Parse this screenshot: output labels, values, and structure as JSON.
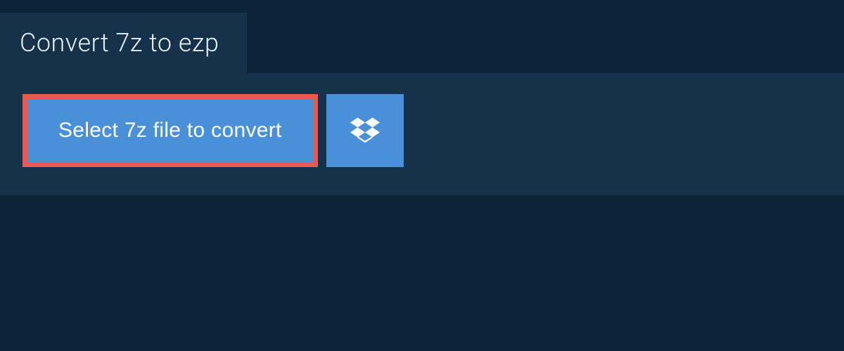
{
  "header": {
    "title": "Convert 7z to ezp"
  },
  "actions": {
    "select_file_label": "Select 7z file to convert",
    "dropbox_icon": "dropbox"
  },
  "colors": {
    "background_dark": "#0d2438",
    "panel": "#16324a",
    "button_blue": "#4a90d9",
    "highlight_border": "#e85a4f",
    "text_light": "#e8eef3"
  }
}
